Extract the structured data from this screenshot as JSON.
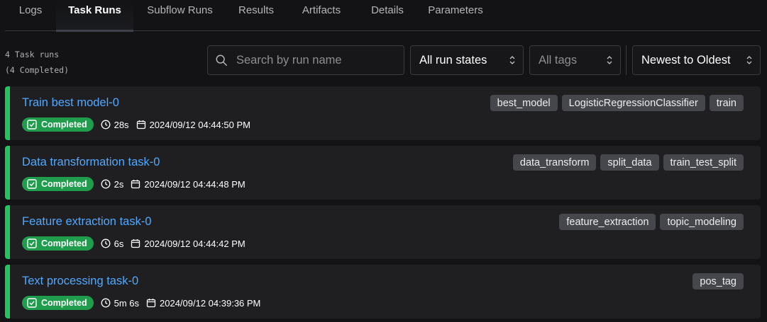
{
  "tabs": [
    {
      "label": "Logs"
    },
    {
      "label": "Task Runs"
    },
    {
      "label": "Subflow Runs"
    },
    {
      "label": "Results"
    },
    {
      "label": "Artifacts"
    },
    {
      "label": "Details"
    },
    {
      "label": "Parameters"
    }
  ],
  "active_tab": "Task Runs",
  "summary": {
    "count_text": "4 Task runs",
    "completed_text": "(4 Completed)"
  },
  "filters": {
    "search_placeholder": "Search by run name",
    "states_value": "All run states",
    "tags_placeholder": "All tags",
    "sort_value": "Newest to Oldest"
  },
  "colors": {
    "accent_link": "#52a8ff",
    "completed": "#22c55e",
    "badge": "#1f9d4d"
  },
  "runs": [
    {
      "name": "Train best model-0",
      "state": "Completed",
      "duration": "28s",
      "timestamp": "2024/09/12 04:44:50 PM",
      "tags": [
        "best_model",
        "LogisticRegressionClassifier",
        "train"
      ]
    },
    {
      "name": "Data transformation task-0",
      "state": "Completed",
      "duration": "2s",
      "timestamp": "2024/09/12 04:44:48 PM",
      "tags": [
        "data_transform",
        "split_data",
        "train_test_split"
      ]
    },
    {
      "name": "Feature extraction task-0",
      "state": "Completed",
      "duration": "6s",
      "timestamp": "2024/09/12 04:44:42 PM",
      "tags": [
        "feature_extraction",
        "topic_modeling"
      ]
    },
    {
      "name": "Text processing task-0",
      "state": "Completed",
      "duration": "5m 6s",
      "timestamp": "2024/09/12 04:39:36 PM",
      "tags": [
        "pos_tag"
      ]
    }
  ]
}
